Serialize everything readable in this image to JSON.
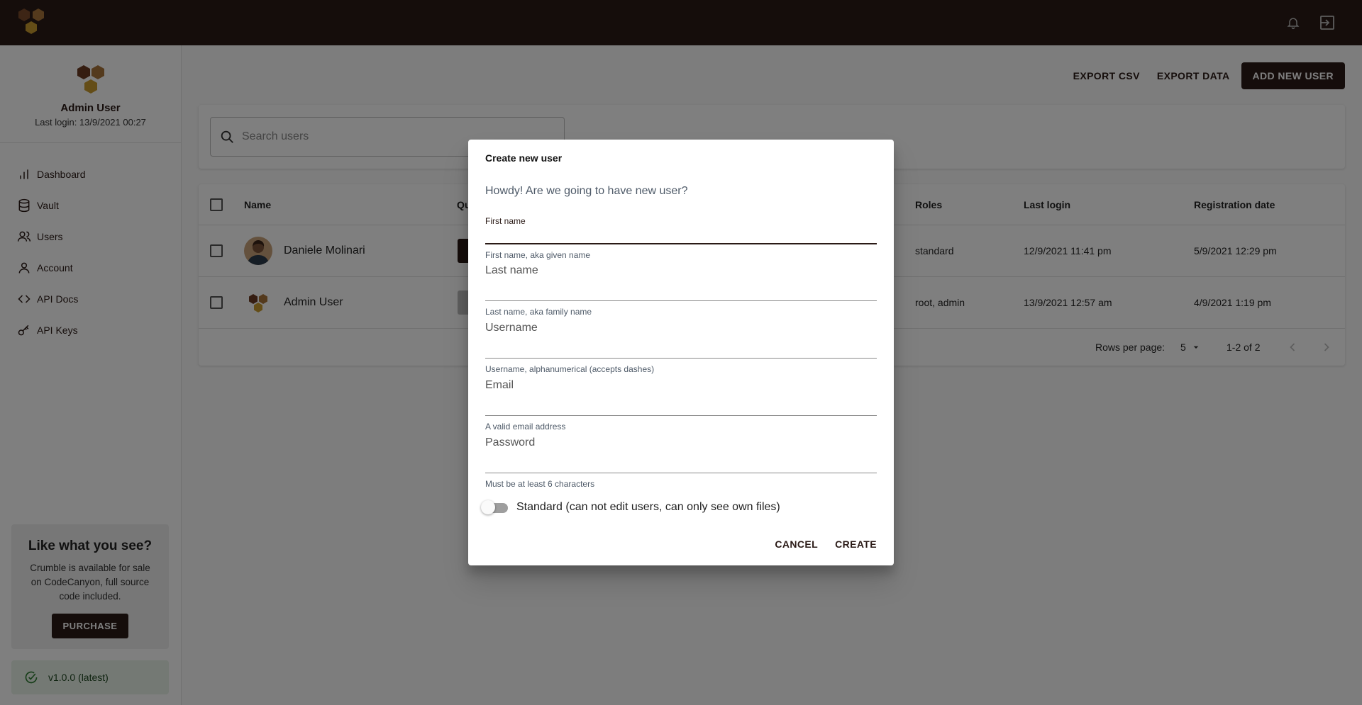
{
  "user": {
    "name": "Admin User",
    "last_login": "Last login: 13/9/2021 00:27"
  },
  "sidebar": {
    "items": [
      {
        "label": "Dashboard",
        "icon": "bar-chart-icon"
      },
      {
        "label": "Vault",
        "icon": "database-icon"
      },
      {
        "label": "Users",
        "icon": "users-icon"
      },
      {
        "label": "Account",
        "icon": "user-icon"
      },
      {
        "label": "API Docs",
        "icon": "code-icon"
      },
      {
        "label": "API Keys",
        "icon": "key-icon"
      }
    ],
    "promo": {
      "title": "Like what you see?",
      "text": "Crumble is available for sale on CodeCanyon, full source code included.",
      "button": "PURCHASE"
    },
    "version": "v1.0.0 (latest)"
  },
  "toolbar": {
    "export_csv": "EXPORT CSV",
    "export_data": "EXPORT DATA",
    "add_user": "ADD NEW USER"
  },
  "search": {
    "placeholder": "Search users"
  },
  "table": {
    "headers": {
      "name": "Name",
      "quick": "Qu",
      "roles": "Roles",
      "last_login": "Last login",
      "registration": "Registration date"
    },
    "rows": [
      {
        "name": "Daniele Molinari",
        "roles": "standard",
        "last_login": "12/9/2021 11:41 pm",
        "registration": "5/9/2021 12:29 pm"
      },
      {
        "name": "Admin User",
        "roles": "root, admin",
        "last_login": "13/9/2021 12:57 am",
        "registration": "4/9/2021 1:19 pm"
      }
    ],
    "footer": {
      "rows_per_page_label": "Rows per page:",
      "rows_per_page": "5",
      "range": "1-2 of 2"
    }
  },
  "dialog": {
    "title": "Create new user",
    "subtitle": "Howdy! Are we going to have new user?",
    "fields": {
      "first_name": {
        "label": "First name",
        "helper": "First name, aka given name"
      },
      "last_name": {
        "label": "Last name",
        "helper": "Last name, aka family name"
      },
      "username": {
        "label": "Username",
        "helper": "Username, alphanumerical (accepts dashes)"
      },
      "email": {
        "label": "Email",
        "helper": "A valid email address"
      },
      "password": {
        "label": "Password",
        "helper": "Must be at least 6 characters"
      }
    },
    "toggle_label": "Standard (can not edit users, can only see own files)",
    "toggle_on": false,
    "cancel": "CANCEL",
    "create": "CREATE"
  },
  "colors": {
    "brand_dark": "#2a1a16",
    "honey": "#c99a2e",
    "brown": "#7a4a2a"
  }
}
